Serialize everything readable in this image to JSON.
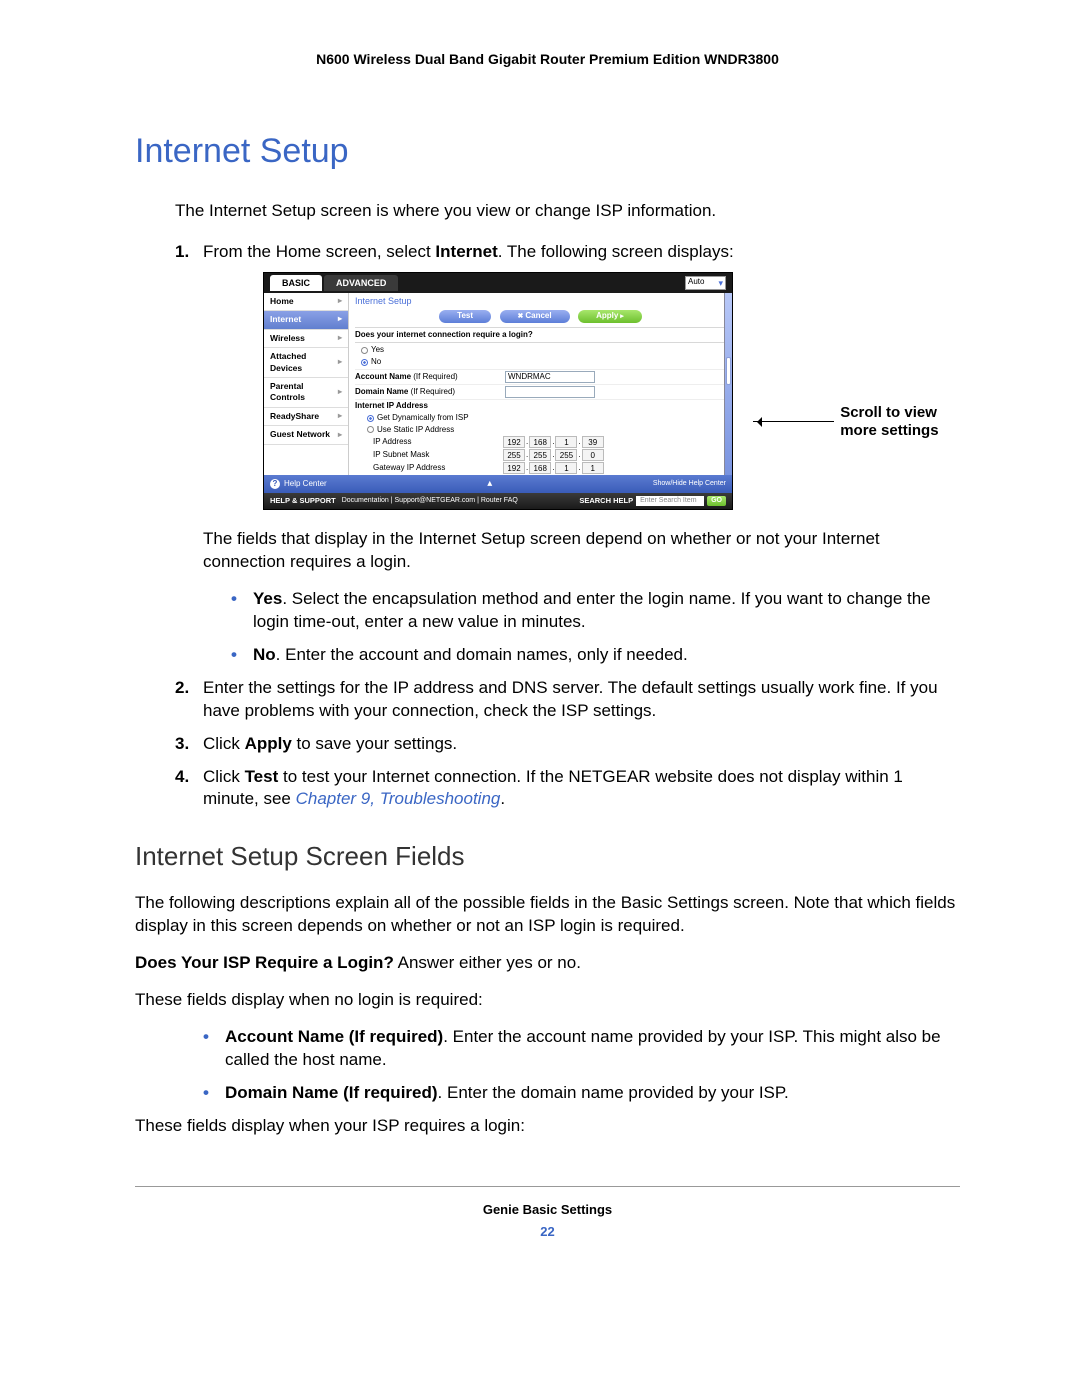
{
  "doc_header": "N600 Wireless Dual Band Gigabit Router Premium Edition WNDR3800",
  "h1": "Internet Setup",
  "intro": "The Internet Setup screen is where you view or change ISP information.",
  "step1_pre": "From the Home screen, select ",
  "step1_bold": "Internet",
  "step1_post": ". The following screen displays:",
  "callout": "Scroll to view more settings",
  "after_shot_1": "The fields that display in the Internet Setup screen depend on whether or not your Internet connection requires a login.",
  "yes_bold": "Yes",
  "yes_text": ". Select the encapsulation method and enter the login name. If you want to change the login time-out, enter a new value in minutes.",
  "no_bold": "No",
  "no_text": ". Enter the account and domain names, only if needed.",
  "step2": "Enter the settings for the IP address and DNS server. The default settings usually work fine. If you have problems with your connection, check the ISP settings.",
  "step3_pre": "Click ",
  "step3_bold": "Apply",
  "step3_post": " to save your settings.",
  "step4_pre": "Click ",
  "step4_bold": "Test",
  "step4_mid": " to test your Internet connection. If the NETGEAR website does not display within 1 minute, see ",
  "step4_link": "Chapter 9, Troubleshooting",
  "step4_end": ".",
  "h2": "Internet Setup Screen Fields",
  "desc": "The following descriptions explain all of the possible fields in the Basic Settings screen. Note that which fields display in this screen depends on whether or not an ISP login is required.",
  "q_bold": "Does Your ISP Require a Login?",
  "q_post": " Answer either yes or no.",
  "nologin_intro": "These fields display when no login is required:",
  "acct_bold": "Account Name (If required)",
  "acct_text": ". Enter the account name provided by your ISP. This might also be called the host name.",
  "dom_bold": "Domain Name (If required)",
  "dom_text": ". Enter the domain name provided by your ISP.",
  "login_intro": "These fields display when your ISP requires a login:",
  "footer_title": "Genie Basic Settings",
  "page_num": "22",
  "shot": {
    "tab_basic": "BASIC",
    "tab_advanced": "ADVANCED",
    "auto": "Auto",
    "panel_title": "Internet Setup",
    "btn_test": "Test",
    "btn_cancel": "Cancel",
    "btn_apply": "Apply",
    "sidebar": [
      "Home",
      "Internet",
      "Wireless",
      "Attached Devices",
      "Parental Controls",
      "ReadyShare",
      "Guest Network"
    ],
    "q": "Does your internet connection require a login?",
    "yes": "Yes",
    "no": "No",
    "acct_lbl": "Account Name",
    "hint": "(If Required)",
    "acct_val": "WNDRMAC",
    "dom_lbl": "Domain Name",
    "ipa_h": "Internet IP Address",
    "r_dyn": "Get Dynamically from ISP",
    "r_static": "Use Static IP Address",
    "ip_lbl": "IP Address",
    "ip": [
      "192",
      "168",
      "1",
      "39"
    ],
    "mask_lbl": "IP Subnet Mask",
    "mask": [
      "255",
      "255",
      "255",
      "0"
    ],
    "gw_lbl": "Gateway IP Address",
    "gw": [
      "192",
      "168",
      "1",
      "1"
    ],
    "help_center": "Help Center",
    "show_hide": "Show/Hide Help Center",
    "hs": "HELP & SUPPORT",
    "docs": "Documentation | Support@NETGEAR.com | Router FAQ",
    "search_help": "SEARCH HELP",
    "search_ph": "Enter Search Item",
    "go": "GO"
  }
}
